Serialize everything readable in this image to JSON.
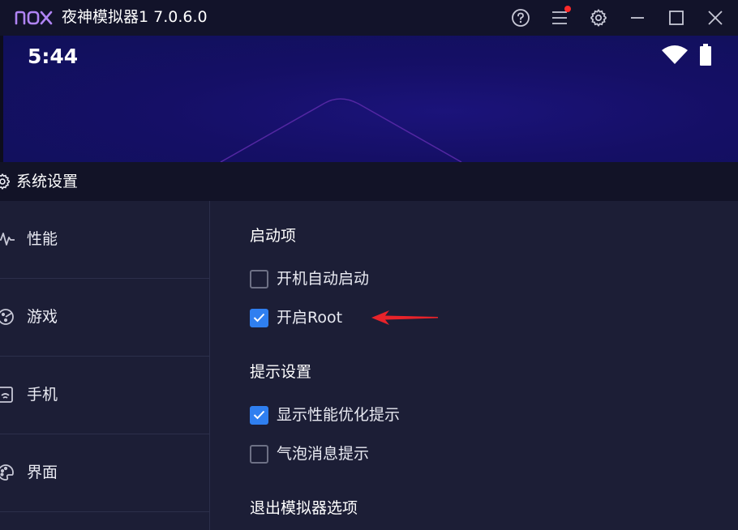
{
  "window": {
    "logo_text": "nox",
    "title": "夜神模拟器1 7.0.6.0",
    "icons": [
      "help-icon",
      "menu-icon",
      "settings-icon",
      "minimize-icon",
      "maximize-icon",
      "close-icon"
    ],
    "notification_dot_color": "#ff2a2a"
  },
  "android": {
    "time": "5:44",
    "icons": [
      "wifi-icon",
      "battery-icon"
    ]
  },
  "dialog": {
    "title": "系统设置",
    "icon": "gear-icon",
    "sidebar": [
      {
        "label": "性能",
        "icon": "pulse-icon"
      },
      {
        "label": "游戏",
        "icon": "gamepad-icon"
      },
      {
        "label": "手机",
        "icon": "phone-icon"
      },
      {
        "label": "界面",
        "icon": "palette-icon"
      }
    ],
    "sections": [
      {
        "title": "启动项",
        "options": [
          {
            "label": "开机自动启动",
            "checked": false
          },
          {
            "label": "开启Root",
            "checked": true
          }
        ]
      },
      {
        "title": "提示设置",
        "options": [
          {
            "label": "显示性能优化提示",
            "checked": true
          },
          {
            "label": "气泡消息提示",
            "checked": false
          }
        ]
      },
      {
        "title": "退出模拟器选项",
        "options": []
      }
    ]
  },
  "colors": {
    "accent": "#2f7ff0",
    "annotation_arrow": "#e8232a",
    "background": "#1c1e36",
    "titlebar": "#12132a"
  }
}
